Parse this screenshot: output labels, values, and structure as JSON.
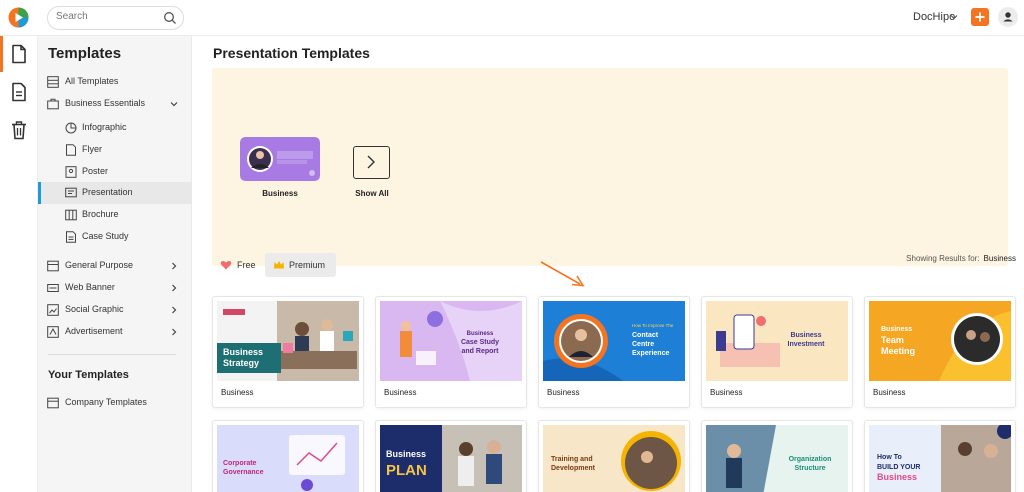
{
  "topbar": {
    "search_placeholder": "Search",
    "brand_menu": "DocHipo"
  },
  "sidebar": {
    "title": "Templates",
    "items": [
      {
        "label": "All Templates"
      },
      {
        "label": "Business Essentials"
      },
      {
        "label": "Infographic"
      },
      {
        "label": "Flyer"
      },
      {
        "label": "Poster"
      },
      {
        "label": "Presentation"
      },
      {
        "label": "Brochure"
      },
      {
        "label": "Case Study"
      },
      {
        "label": "General Purpose"
      },
      {
        "label": "Web Banner"
      },
      {
        "label": "Social Graphic"
      },
      {
        "label": "Advertisement"
      }
    ],
    "your_templates_title": "Your Templates",
    "company_templates": "Company Templates"
  },
  "main": {
    "page_title": "Presentation Templates",
    "category_card": {
      "label": "Business"
    },
    "show_all": "Show All",
    "filters": {
      "free": "Free",
      "premium": "Premium"
    },
    "results_prefix": "Showing Results for:",
    "results_value": "Business"
  },
  "thumbnails": [
    {
      "caption": "Business",
      "headline": "Business Strategy",
      "bg": "#f3f3f3",
      "accent": "#1e6f74"
    },
    {
      "caption": "Business",
      "headline": "Business Case Study and Report",
      "bg": "#d9b8f1",
      "accent": "#5b2a86"
    },
    {
      "caption": "Business",
      "headline": "Contact Centre Experience",
      "kicker": "How To Improve The",
      "bg": "#1d7fd6",
      "accent": "#ffffff"
    },
    {
      "caption": "Business",
      "headline": "Business Investment",
      "bg": "#fbe6c2",
      "accent": "#3b3b8f"
    },
    {
      "caption": "Business",
      "headline": "Business Team Meeting",
      "bg": "#f5a623",
      "accent": "#ffffff"
    }
  ],
  "thumbnails_row2": [
    {
      "headline": "Corporate Governance",
      "bg": "#d9dcfb",
      "accent": "#c0267a"
    },
    {
      "headline": "Business PLAN",
      "bg": "#1d2d6b",
      "accent": "#f6c343"
    },
    {
      "headline": "Training and Development",
      "bg": "#f7e6c8",
      "accent": "#7a3b12"
    },
    {
      "headline": "Organization Structure",
      "bg": "#e6f3ef",
      "accent": "#1f8f7a"
    },
    {
      "headline": "How To BUILD YOUR Business",
      "bg": "#e9eefb",
      "accent": "#e34a86"
    }
  ],
  "colors": {
    "accent": "#f47521",
    "active": "#1e9bd7",
    "banner": "#fdf4e1"
  }
}
